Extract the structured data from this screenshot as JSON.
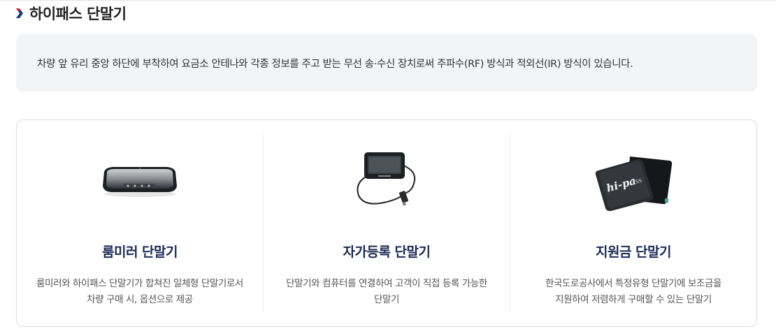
{
  "section": {
    "title": "하이패스 단말기",
    "description": "차량 앞 유리 중앙 하단에 부착하여 요금소 안테나와 각종 정보를 주고 받는 무선 송·수신 장치로써 주파수(RF) 방식과 적외선(IR) 방식이 있습니다."
  },
  "cards": [
    {
      "icon": "room-mirror-icon",
      "title": "룸미러 단말기",
      "lines": [
        "룸미러와 하이패스 단말기가 합쳐진 일체형 단말기로서",
        "차량 구매 시, 옵션으로 제공"
      ]
    },
    {
      "icon": "self-registration-device-icon",
      "title": "자가등록 단말기",
      "lines": [
        "단말기와 컴퓨터를 연결하여 고객이 직접 등록 가능한",
        "단말기"
      ]
    },
    {
      "icon": "hipass-device-icon",
      "title": "지원금 단말기",
      "lines": [
        "한국도로공사에서 특정유형 단말기에 보조금을",
        "지원하여 저렴하게 구매할 수 있는 단말기"
      ]
    }
  ],
  "colors": {
    "accent_red": "#e0252c",
    "accent_blue": "#1b3a8c",
    "title_navy": "#1b2a57"
  }
}
